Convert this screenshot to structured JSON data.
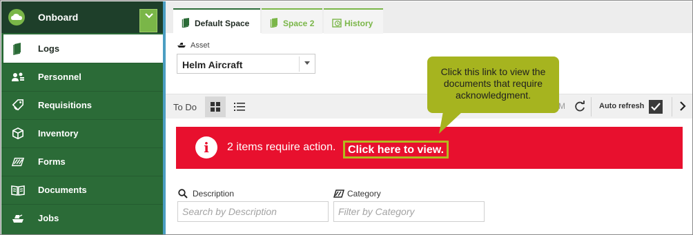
{
  "app": {
    "title": "Onboard"
  },
  "sidebar": {
    "items": [
      {
        "label": "Logs",
        "icon": "book-icon",
        "active": true
      },
      {
        "label": "Personnel",
        "icon": "users-icon"
      },
      {
        "label": "Requisitions",
        "icon": "tag-icon"
      },
      {
        "label": "Inventory",
        "icon": "cube-icon"
      },
      {
        "label": "Forms",
        "icon": "stack-icon"
      },
      {
        "label": "Documents",
        "icon": "open-book-icon"
      },
      {
        "label": "Jobs",
        "icon": "job-icon"
      }
    ]
  },
  "tabs": [
    {
      "label": "Default Space",
      "active": true
    },
    {
      "label": "Space 2"
    },
    {
      "label": "History"
    }
  ],
  "asset": {
    "label": "Asset",
    "value": "Helm Aircraft"
  },
  "toolbar": {
    "todo_label": "To Do",
    "partial_text": "M",
    "auto_refresh_label": "Auto refresh",
    "auto_refresh_checked": true
  },
  "alert": {
    "message": "2 items require action.",
    "link_text": "Click here to view."
  },
  "callout": {
    "text": "Click this link to view the documents that require acknowledgment."
  },
  "filters": {
    "description": {
      "label": "Description",
      "placeholder": "Search by Description"
    },
    "category": {
      "label": "Category",
      "placeholder": "Filter by Category"
    }
  },
  "colors": {
    "sidebar": "#2b6b37",
    "brand_bar": "#1e3f2a",
    "accent_green": "#7ab648",
    "alert_red": "#e8102e",
    "callout": "#a6b41f"
  }
}
